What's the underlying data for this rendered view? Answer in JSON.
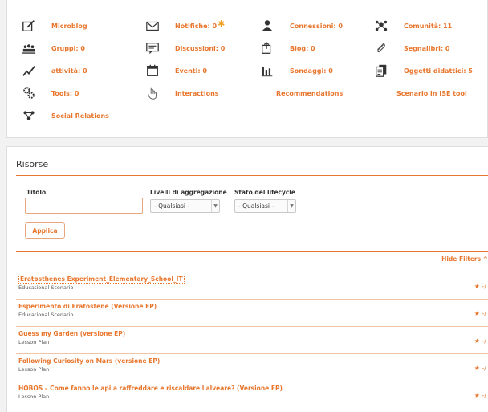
{
  "nav": {
    "items": [
      {
        "id": "microblog",
        "label": "Microblog",
        "icon": "compose-icon"
      },
      {
        "id": "notifiche",
        "label": "Notifiche: 0",
        "icon": "envelope-icon",
        "badge": "✱"
      },
      {
        "id": "connessioni",
        "label": "Connessioni: 0",
        "icon": "person-icon"
      },
      {
        "id": "comunita",
        "label": "Comunità: 11",
        "icon": "community-icon"
      },
      {
        "id": "gruppi",
        "label": "Gruppi: 0",
        "icon": "group-icon"
      },
      {
        "id": "discussioni",
        "label": "Discussioni: 0",
        "icon": "chat-icon"
      },
      {
        "id": "blog",
        "label": "Blog: 0",
        "icon": "blog-icon"
      },
      {
        "id": "segnalibri",
        "label": "Segnalibri: 0",
        "icon": "paperclip-icon"
      },
      {
        "id": "attivita",
        "label": "attività: 0",
        "icon": "activity-icon"
      },
      {
        "id": "eventi",
        "label": "Eventi: 0",
        "icon": "calendar-icon"
      },
      {
        "id": "sondaggi",
        "label": "Sondaggi: 0",
        "icon": "bar-chart-icon"
      },
      {
        "id": "oggetti",
        "label": "Oggetti didattici: 5",
        "icon": "documents-icon"
      },
      {
        "id": "tools",
        "label": "Tools: 0",
        "icon": "gears-icon"
      },
      {
        "id": "interactions",
        "label": "Interactions",
        "icon": "hand-cursor-icon"
      },
      {
        "id": "recommendations",
        "label": "Recommendations",
        "icon": ""
      },
      {
        "id": "scenario",
        "label": "Scenario in ISE tool",
        "icon": ""
      },
      {
        "id": "social",
        "label": "Social Relations",
        "icon": "social-network-icon"
      }
    ]
  },
  "resources": {
    "title": "Risorse",
    "filters": {
      "title_label": "Titolo",
      "title_value": "",
      "aggregation_label": "Livelli di aggregazione",
      "aggregation_value": "- Qualsiasi -",
      "lifecycle_label": "Stato del lifecycle",
      "lifecycle_value": "- Qualsiasi -",
      "apply_label": "Applica"
    },
    "hide_filters_label": "Hide Filters ^",
    "results": [
      {
        "title": "Eratosthenes Experiment_Elementary_School_IT",
        "type": "Educational Scenario",
        "rating": "★ -/"
      },
      {
        "title": "Esperimento di Eratostene (Versione EP)",
        "type": "Educational Scenario",
        "rating": "★ -/"
      },
      {
        "title": "Guess my Garden (versione EP)",
        "type": "Lesson Plan",
        "rating": "★ -/"
      },
      {
        "title": "Following Curiosity on Mars (versione EP)",
        "type": "Lesson Plan",
        "rating": "★ -/"
      },
      {
        "title": "HOBOS – Come fanno le api a raffreddare e riscaldare l'alveare? (Versione EP)",
        "type": "Lesson Plan",
        "rating": "★ -/"
      }
    ]
  }
}
